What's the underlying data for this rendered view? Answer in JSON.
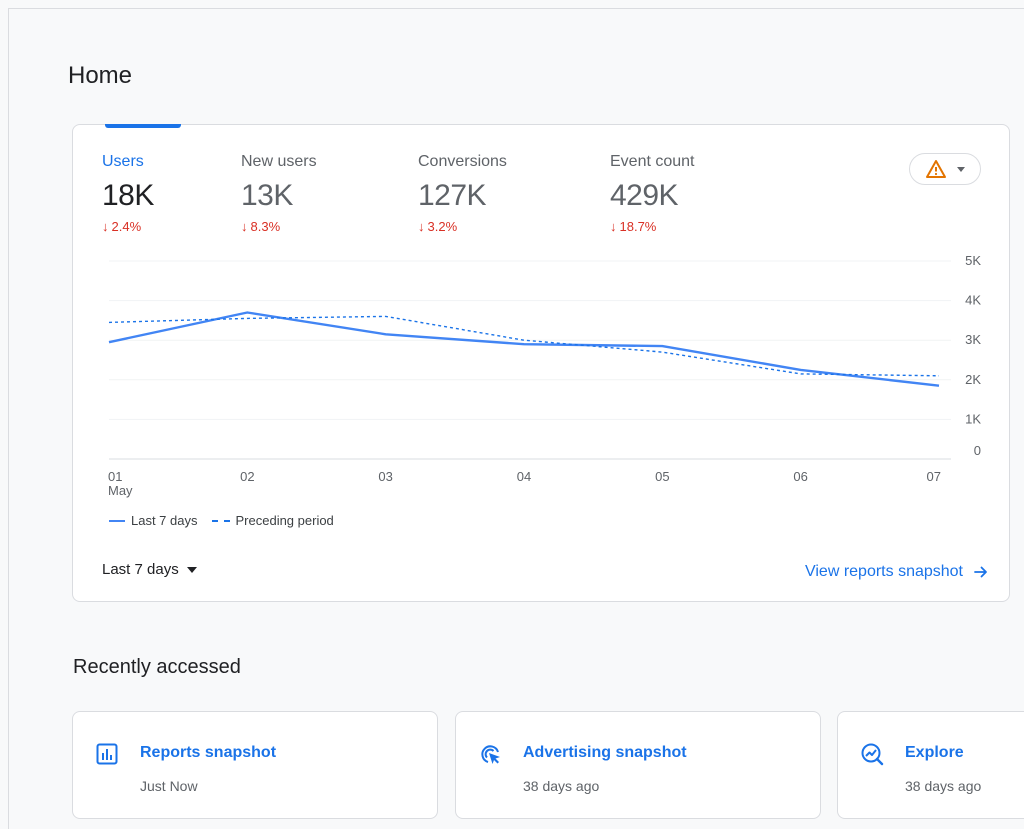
{
  "page": {
    "title": "Home"
  },
  "metrics": [
    {
      "label": "Users",
      "value": "18K",
      "change": "2.4%",
      "direction": "down",
      "active": true
    },
    {
      "label": "New users",
      "value": "13K",
      "change": "8.3%",
      "direction": "down",
      "active": false
    },
    {
      "label": "Conversions",
      "value": "127K",
      "change": "3.2%",
      "direction": "down",
      "active": false
    },
    {
      "label": "Event count",
      "value": "429K",
      "change": "18.7%",
      "direction": "down",
      "active": false
    }
  ],
  "alert_icon": "warning-triangle-icon",
  "chart_data": {
    "type": "line",
    "x": [
      "01",
      "02",
      "03",
      "04",
      "05",
      "06",
      "07"
    ],
    "x_sublabel_first": "May",
    "y_ticks": [
      "5K",
      "4K",
      "3K",
      "2K",
      "1K",
      "0"
    ],
    "ylim": [
      0,
      5000
    ],
    "grid": true,
    "legend_position": "bottom-left",
    "series": [
      {
        "name": "Last 7 days",
        "style": "solid",
        "color": "#4285f4",
        "values": [
          2950,
          3700,
          3150,
          2900,
          2850,
          2250,
          1850
        ]
      },
      {
        "name": "Preceding period",
        "style": "dashed",
        "color": "#1a73e8",
        "values": [
          3450,
          3550,
          3600,
          3000,
          2700,
          2150,
          2100
        ]
      }
    ]
  },
  "legend": {
    "current": "Last 7 days",
    "previous": "Preceding period"
  },
  "controls": {
    "range_label": "Last 7 days",
    "view_link": "View reports snapshot"
  },
  "recent": {
    "title": "Recently accessed",
    "items": [
      {
        "title": "Reports snapshot",
        "sub": "Just Now",
        "icon": "bar-chart-icon"
      },
      {
        "title": "Advertising snapshot",
        "sub": "38 days ago",
        "icon": "cursor-click-icon"
      },
      {
        "title": "Explore",
        "sub": "38 days ago",
        "icon": "explore-trend-icon"
      }
    ]
  },
  "colors": {
    "accent": "#1a73e8",
    "negative": "#d93025",
    "alert": "#e37400"
  }
}
